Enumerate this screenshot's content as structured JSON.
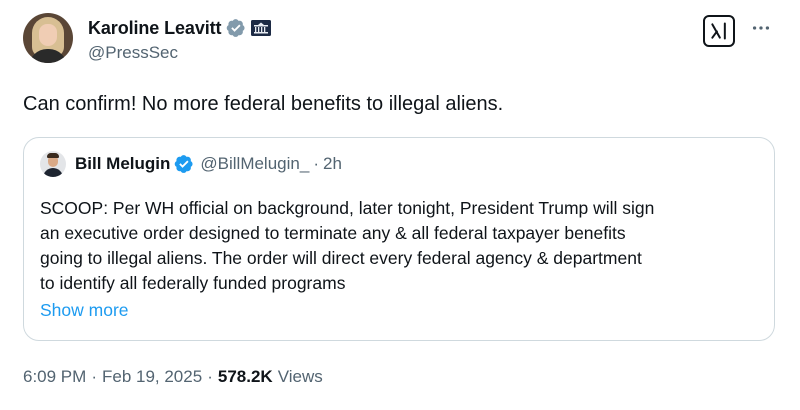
{
  "author": {
    "name": "Karoline Leavitt",
    "handle": "@PressSec",
    "verified_color": "#829aab",
    "avatar_icon": "portrait-avatar"
  },
  "tweet": {
    "text": "Can confirm! No more federal benefits to illegal aliens."
  },
  "quoted_tweet": {
    "name": "Bill Melugin",
    "handle": "@BillMelugin_",
    "separator": "·",
    "time": "2h",
    "verified_color": "#1d9bf0",
    "text_lines": [
      "SCOOP: Per WH official on background, later tonight, President Trump will sign",
      "an executive order designed to terminate any & all federal taxpayer benefits",
      "going to illegal aliens. The order will direct every federal agency & department",
      "to identify all federally funded programs"
    ],
    "show_more": "Show more"
  },
  "meta": {
    "time": "6:09 PM",
    "sep1": "·",
    "date": "Feb 19, 2025",
    "sep2": "·",
    "views_count": "578.2K",
    "views_label": "Views"
  },
  "actions": {
    "grok_icon": "grok-icon",
    "more_icon": "more-horizontal-icon"
  },
  "colors": {
    "text_primary": "#0f1419",
    "text_secondary": "#536471",
    "link": "#1d9bf0",
    "border": "#cfd9de"
  }
}
